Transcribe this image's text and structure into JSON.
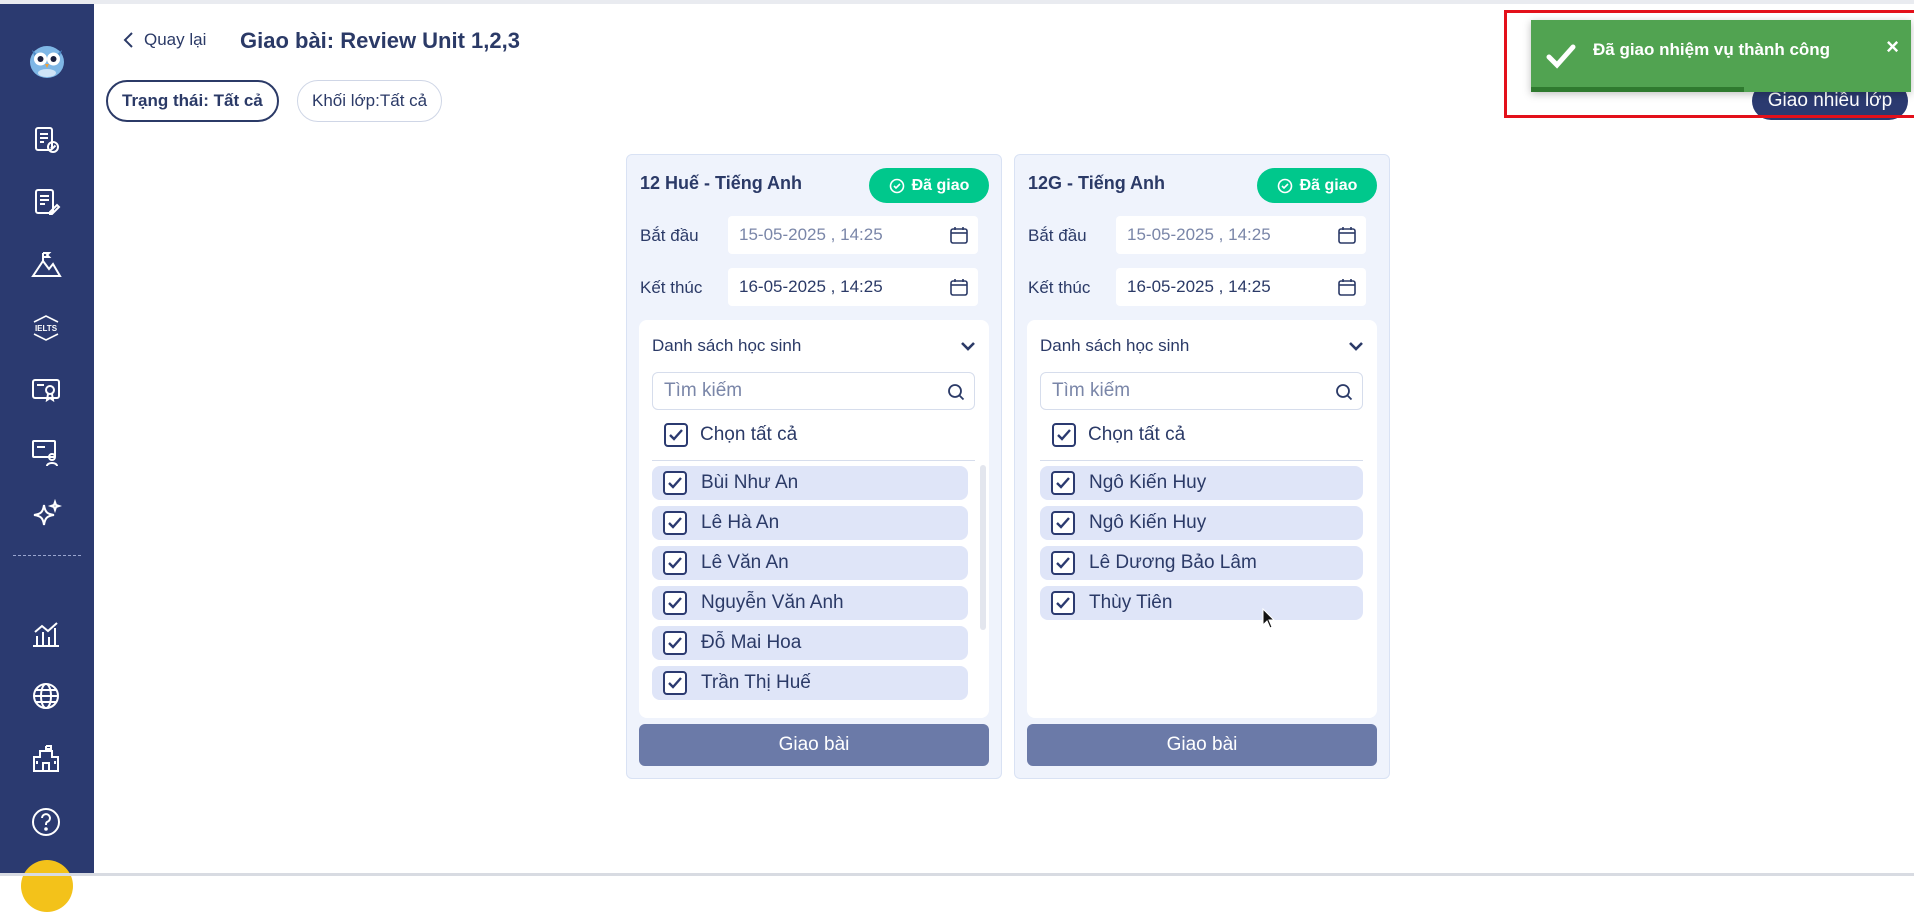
{
  "header": {
    "back_label": "Quay lại",
    "title": "Giao bài: Review Unit 1,2,3"
  },
  "filters": {
    "status_chip": "Trạng thái: Tất cả",
    "grade_chip": "Khối lớp:Tất cả"
  },
  "actions": {
    "multi_assign_label": "Giao nhiều lớp"
  },
  "toast": {
    "message": "Đã giao nhiệm vụ thành công",
    "close_glyph": "×",
    "color": "#51a351"
  },
  "sidebar": {
    "icons": [
      "owl-logo",
      "assignment-check-icon",
      "document-edit-icon",
      "mountain-flag-icon",
      "ielts-icon",
      "certificate-icon",
      "presenter-icon",
      "sparkle-icon",
      "analytics-icon",
      "globe-icon",
      "school-building-icon",
      "help-icon"
    ],
    "color": "#2b3a70"
  },
  "cards": [
    {
      "title": "12 Huế - Tiếng Anh",
      "badge": "Đã giao",
      "start_label": "Bắt đầu",
      "start_value": "15-05-2025 , 14:25",
      "end_label": "Kết thúc",
      "end_value": "16-05-2025 , 14:25",
      "list_title": "Danh sách học sinh",
      "search_placeholder": "Tìm kiếm",
      "select_all": "Chọn tất cả",
      "students": [
        "Bùi Như An",
        "Lê Hà An",
        "Lê Văn An",
        "Nguyễn Văn Anh",
        "Đỗ Mai Hoa",
        "Trần Thị Huế"
      ],
      "assign_label": "Giao bài"
    },
    {
      "title": "12G - Tiếng Anh",
      "badge": "Đã giao",
      "start_label": "Bắt đầu",
      "start_value": "15-05-2025 , 14:25",
      "end_label": "Kết thúc",
      "end_value": "16-05-2025 , 14:25",
      "list_title": "Danh sách học sinh",
      "search_placeholder": "Tìm kiếm",
      "select_all": "Chọn tất cả",
      "students": [
        "Ngô Kiến Huy",
        "Ngô Kiến Huy",
        "Lê Dương Bảo Lâm",
        "Thùy Tiên"
      ],
      "assign_label": "Giao bài"
    }
  ],
  "colors": {
    "primary": "#2b3a70",
    "badge_green": "#00c88c",
    "assign_button": "#6b7aa8",
    "toast_border": "#e3101a"
  }
}
